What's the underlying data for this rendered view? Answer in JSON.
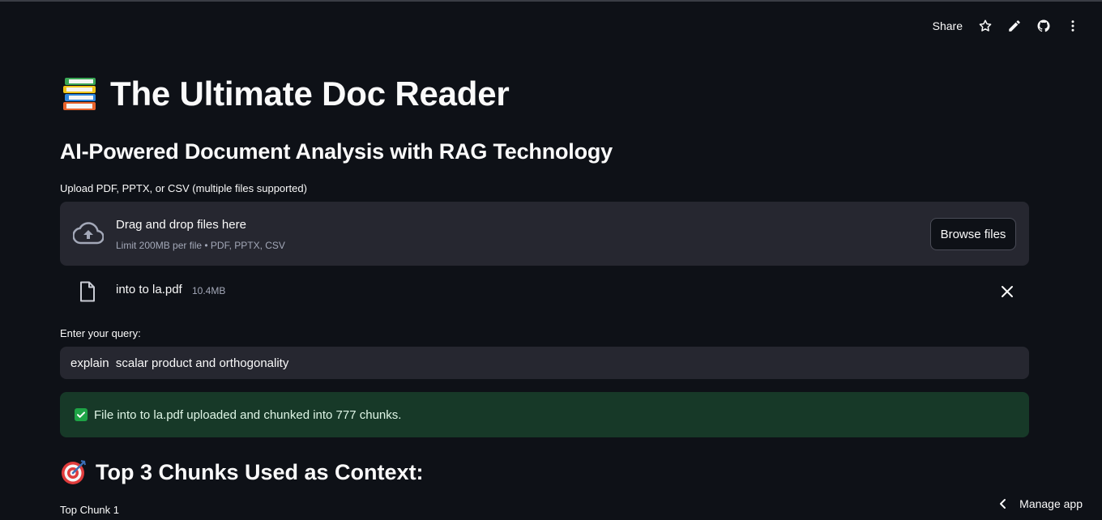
{
  "toolbar": {
    "share_label": "Share",
    "icons": [
      "star-icon",
      "pencil-icon",
      "github-icon",
      "more-vertical-icon"
    ]
  },
  "header": {
    "title_icon": "books-emoji-icon",
    "title": "The Ultimate Doc Reader",
    "subtitle": "AI-Powered Document Analysis with RAG Technology"
  },
  "uploader": {
    "label": "Upload PDF, PPTX, or CSV (multiple files supported)",
    "dropzone_title": "Drag and drop files here",
    "dropzone_hint": "Limit 200MB per file • PDF, PPTX, CSV",
    "browse_label": "Browse files",
    "file": {
      "name": "into to la.pdf",
      "size": "10.4MB"
    }
  },
  "query": {
    "label": "Enter your query:",
    "value": "explain  scalar product and orthogonality"
  },
  "status": {
    "message": "File into to la.pdf uploaded and chunked into 777 chunks.",
    "color": "#173928"
  },
  "results": {
    "heading": "Top 3 Chunks Used as Context:",
    "first_chunk_label": "Top Chunk 1"
  },
  "footer": {
    "manage_app_label": "Manage app"
  },
  "colors": {
    "background": "#0e1117",
    "panel": "#262730",
    "success_bg": "#173928",
    "success_check": "#1ea446"
  }
}
